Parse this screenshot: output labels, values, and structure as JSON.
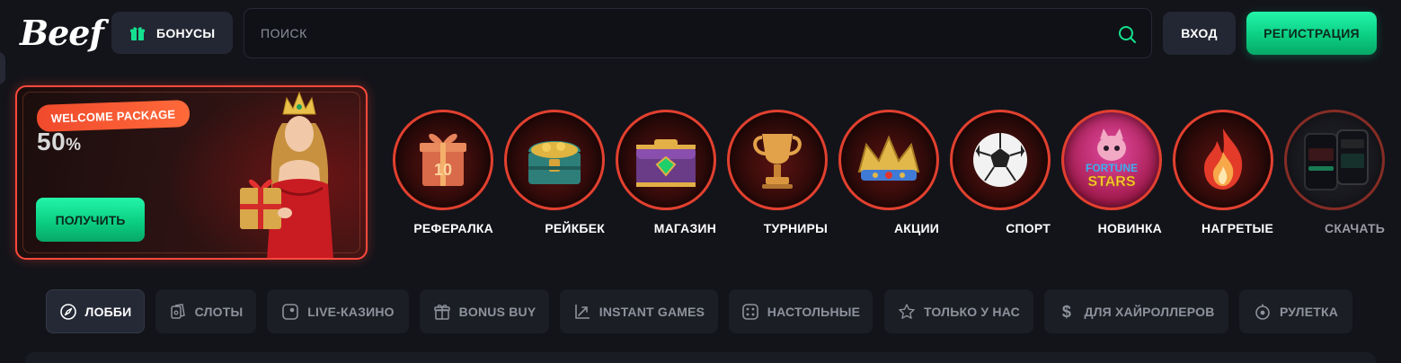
{
  "header": {
    "logo_text": "Beef",
    "bonus_label": "БОНУСЫ",
    "search_placeholder": "ПОИСК",
    "login_label": "ВХОД",
    "register_label": "РЕГИСТРАЦИЯ"
  },
  "promo": {
    "badge": "WELCOME PACKAGE",
    "percent_value": "50",
    "percent_sign": "%",
    "cta_label": "ПОЛУЧИТЬ"
  },
  "circles": [
    {
      "label": "РЕФЕРАЛКА",
      "icon": "gift-box-icon"
    },
    {
      "label": "РЕЙКБЕК",
      "icon": "treasure-chest-icon"
    },
    {
      "label": "МАГАЗИН",
      "icon": "shop-chest-icon"
    },
    {
      "label": "ТУРНИРЫ",
      "icon": "trophy-icon"
    },
    {
      "label": "АКЦИИ",
      "icon": "crown-icon"
    },
    {
      "label": "СПОРТ",
      "icon": "soccer-ball-icon"
    },
    {
      "label": "НОВИНКА",
      "icon": "fortune-stars-icon",
      "art_text_1": "FORTUNE",
      "art_text_2": "STARS"
    },
    {
      "label": "НАГРЕТЫЕ",
      "icon": "flame-icon"
    },
    {
      "label": "СКАЧАТЬ",
      "icon": "phone-app-icon"
    }
  ],
  "tabs": [
    {
      "label": "ЛОББИ",
      "icon": "compass-icon",
      "active": true
    },
    {
      "label": "СЛОТЫ",
      "icon": "cards-icon",
      "active": false
    },
    {
      "label": "LIVE-КАЗИНО",
      "icon": "live-icon",
      "active": false
    },
    {
      "label": "BONUS BUY",
      "icon": "gift-icon",
      "active": false
    },
    {
      "label": "INSTANT GAMES",
      "icon": "chart-arrow-icon",
      "active": false
    },
    {
      "label": "НАСТОЛЬНЫЕ",
      "icon": "dice-icon",
      "active": false
    },
    {
      "label": "ТОЛЬКО У НАС",
      "icon": "star-icon",
      "active": false
    },
    {
      "label": "ДЛЯ ХАЙРОЛЛЕРОВ",
      "icon": "dollar-icon",
      "active": false
    },
    {
      "label": "РУЛЕТКА",
      "icon": "roulette-icon",
      "active": false
    }
  ],
  "colors": {
    "accent_green": "#0bcf83",
    "accent_red": "#e2402f",
    "background": "#13141a"
  }
}
